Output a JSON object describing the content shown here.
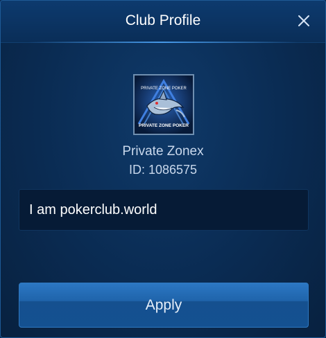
{
  "header": {
    "title": "Club Profile",
    "close_icon": "close-icon"
  },
  "club": {
    "logo_icon": "shark-club-logo",
    "logo_text_top": "PRIVATE ZONE POKER",
    "logo_text_bottom": "PRIVATE ZONE POKER",
    "name": "Private Zonex",
    "id_text": "ID: 1086575",
    "description": "I am pokerclub.world"
  },
  "actions": {
    "apply_label": "Apply"
  },
  "colors": {
    "background": "#0a2b52",
    "accent": "#2c77c3",
    "text_primary": "#ffffff",
    "text_secondary": "#c9d8ec"
  }
}
